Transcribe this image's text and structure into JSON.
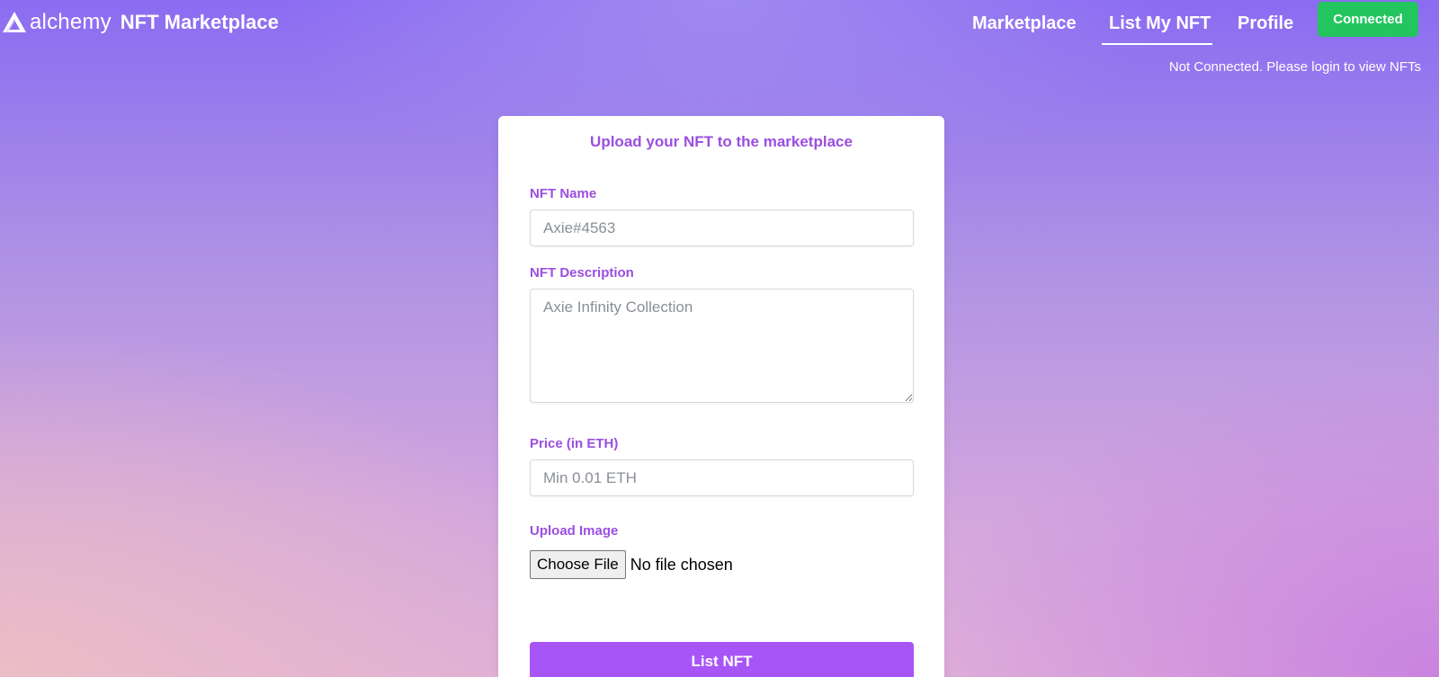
{
  "header": {
    "logo_icon": "alchemy-logo-icon",
    "logo_word": "alchemy",
    "title": "NFT Marketplace",
    "nav": [
      {
        "label": "Marketplace",
        "active": false
      },
      {
        "label": "List My NFT",
        "active": true
      },
      {
        "label": "Profile",
        "active": false
      }
    ],
    "connect_label": "Connected",
    "connect_color": "#22c55e",
    "status": "Not Connected. Please login to view NFTs"
  },
  "form": {
    "title": "Upload your NFT to the marketplace",
    "name_label": "NFT Name",
    "name_placeholder": "Axie#4563",
    "name_value": "",
    "description_label": "NFT Description",
    "description_placeholder": "Axie Infinity Collection",
    "description_value": "",
    "price_label": "Price (in ETH)",
    "price_placeholder": "Min 0.01 ETH",
    "price_value": "",
    "image_label": "Upload Image",
    "file_button": "Choose File",
    "file_status": "No file chosen",
    "submit_label": "List NFT",
    "accent_color": "#9b4ee0",
    "button_color": "#a855f7"
  }
}
